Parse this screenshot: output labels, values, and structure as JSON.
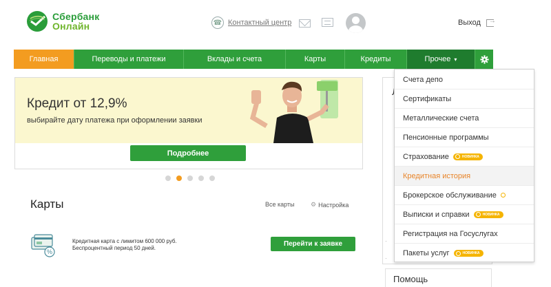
{
  "header": {
    "logo_line1": "Сбербанк",
    "logo_line2": "Онлайн",
    "contact_center": "Контактный центр",
    "logout": "Выход"
  },
  "nav": {
    "home": "Главная",
    "transfers": "Переводы и платежи",
    "deposits": "Вклады и счета",
    "cards": "Карты",
    "credits": "Кредиты",
    "other": "Прочее",
    "other_caret": "▾",
    "settings_icon": "gear-icon"
  },
  "banner": {
    "title": "Кредит от 12,9%",
    "subtitle": "выбирайте дату платежа при оформлении заявки",
    "button": "Подробнее",
    "slides_total": 5,
    "slide_active": 2
  },
  "cards_section": {
    "title": "Карты",
    "all_cards": "Все карты",
    "settings": "Настройка",
    "offer_line1": "Кредитная карта с лимитом 600 000 руб.",
    "offer_line2": "Беспроцентный период 50 дней.",
    "apply_button": "Перейти к заявке"
  },
  "side": {
    "help": "Помощь"
  },
  "dropdown": {
    "items": [
      {
        "label": "Счета депо"
      },
      {
        "label": "Сертификаты"
      },
      {
        "label": "Металлические счета"
      },
      {
        "label": "Пенсионные программы"
      },
      {
        "label": "Страхование",
        "badge": "НОВИНКА"
      },
      {
        "label": "Кредитная история"
      },
      {
        "label": "Брокерское обслуживание"
      },
      {
        "label": "Выписки и справки",
        "badge": "НОВИНКА"
      },
      {
        "label": "Регистрация на Госуслугах"
      },
      {
        "label": "Пакеты услуг",
        "badge": "НОВИНКА"
      }
    ]
  },
  "colors": {
    "brand_green": "#2f9f3b",
    "active_orange": "#f39c20",
    "badge_yellow": "#f5b400",
    "banner_bg": "#fbf7cf"
  }
}
